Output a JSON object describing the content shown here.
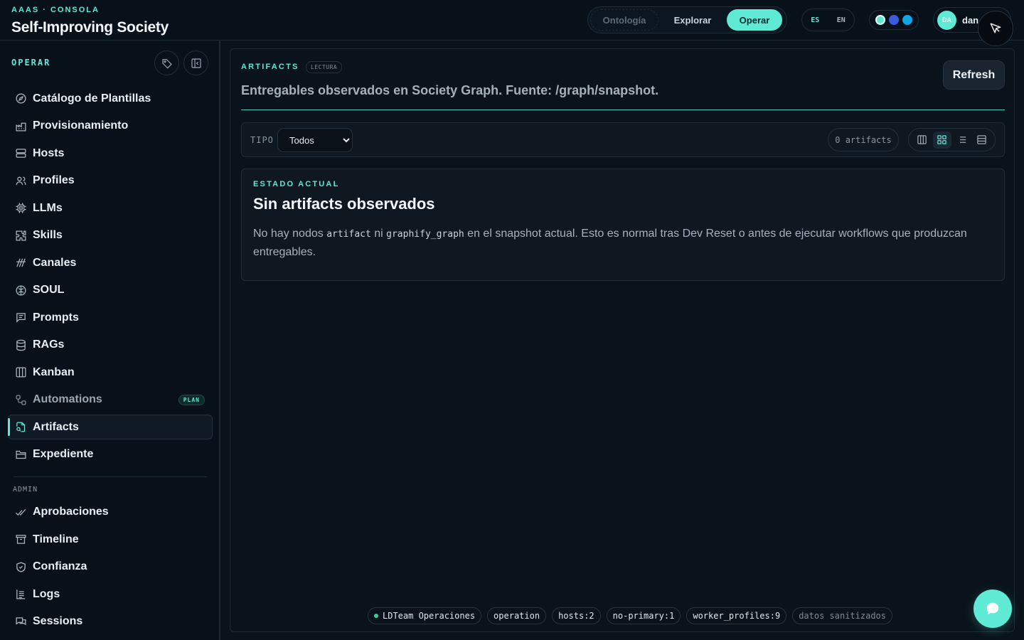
{
  "header": {
    "eyebrow": "AAAS · CONSOLA",
    "title": "Self-Improving Society",
    "nav": [
      "Ontología",
      "Explorar",
      "Operar"
    ],
    "nav_active": "Operar",
    "langs": [
      "ES",
      "EN"
    ],
    "lang_active": "ES",
    "theme_colors": [
      "#5eead4",
      "#3b5bdb",
      "#0ea5e9"
    ],
    "user": {
      "initials": "DA",
      "name": "dan"
    }
  },
  "sidebar": {
    "heading": "OPERAR",
    "items": [
      {
        "label": "Catálogo de Plantillas",
        "icon": "compass-icon"
      },
      {
        "label": "Provisionamiento",
        "icon": "factory-icon"
      },
      {
        "label": "Hosts",
        "icon": "server-icon"
      },
      {
        "label": "Profiles",
        "icon": "users-icon"
      },
      {
        "label": "LLMs",
        "icon": "cpu-icon"
      },
      {
        "label": "Skills",
        "icon": "puzzle-icon"
      },
      {
        "label": "Canales",
        "icon": "channels-icon"
      },
      {
        "label": "SOUL",
        "icon": "brain-icon"
      },
      {
        "label": "Prompts",
        "icon": "message-icon"
      },
      {
        "label": "RAGs",
        "icon": "database-icon"
      },
      {
        "label": "Kanban",
        "icon": "kanban-icon"
      },
      {
        "label": "Automations",
        "icon": "workflow-icon",
        "badge": "PLAN"
      },
      {
        "label": "Artifacts",
        "icon": "file-search-icon"
      },
      {
        "label": "Expediente",
        "icon": "folder-icon"
      }
    ],
    "admin_heading": "ADMIN",
    "admin_items": [
      {
        "label": "Aprobaciones",
        "icon": "check-check-icon"
      },
      {
        "label": "Timeline",
        "icon": "archive-icon"
      },
      {
        "label": "Confianza",
        "icon": "shield-icon"
      },
      {
        "label": "Logs",
        "icon": "logs-icon"
      },
      {
        "label": "Sessions",
        "icon": "chats-icon"
      }
    ],
    "active": "Artifacts"
  },
  "main": {
    "eyebrow": "ARTIFACTS",
    "mode_badge": "LECTURA",
    "subtitle": "Entregables observados en Society Graph. Fuente: /graph/snapshot.",
    "refresh_label": "Refresh",
    "filter": {
      "label": "TIPO",
      "selected": "Todos",
      "count": "0 artifacts",
      "views": [
        "columns-icon",
        "grid-icon",
        "list-icon",
        "table-icon"
      ],
      "active_view": "grid-icon"
    },
    "state": {
      "eyebrow": "ESTADO ACTUAL",
      "title": "Sin artifacts observados",
      "body_1": "No hay nodos ",
      "code_1": "artifact",
      "body_2": " ni ",
      "code_2": "graphify_graph",
      "body_3": " en el snapshot actual. Esto es normal tras Dev Reset o antes de ejecutar workflows que produzcan entregables."
    }
  },
  "footer": {
    "chips": [
      "LDTeam Operaciones",
      "operation",
      "hosts:2",
      "no-primary:1",
      "worker_profiles:9",
      "datos sanitizados"
    ]
  },
  "accent_color": "#5eead4"
}
